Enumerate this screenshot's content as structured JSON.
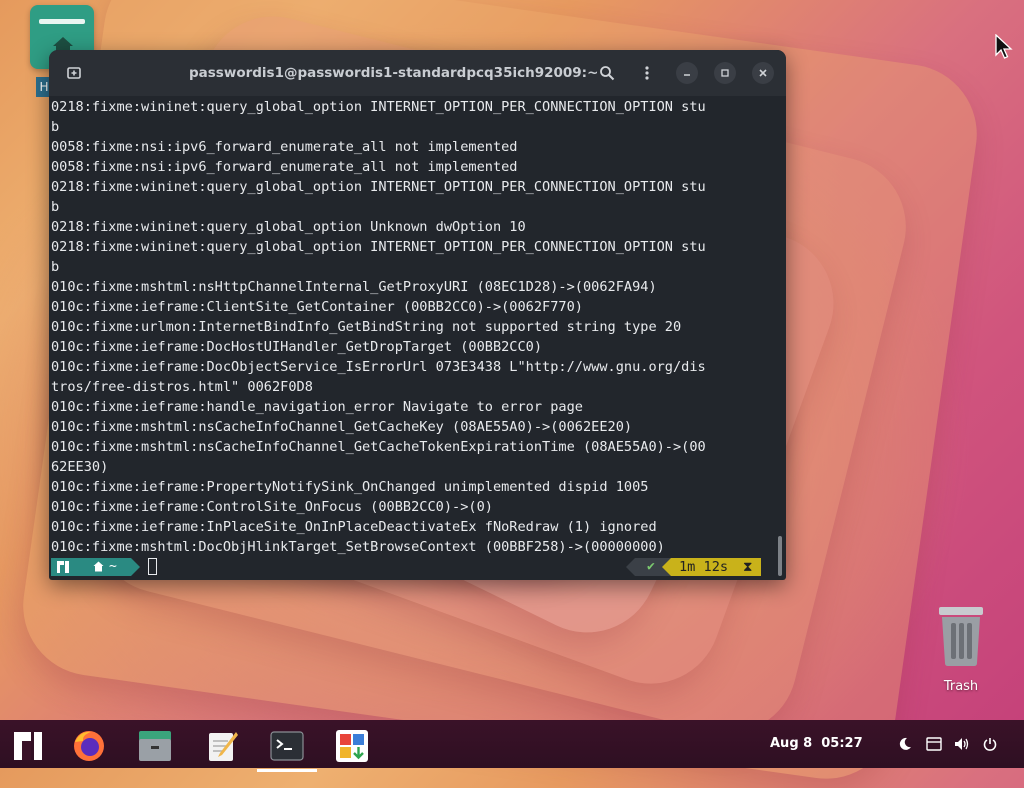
{
  "desktop": {
    "icons": [
      {
        "name": "Home",
        "label": "H"
      },
      {
        "name": "Trash",
        "label": "Trash"
      }
    ]
  },
  "terminal": {
    "title": "passwordis1@passwordis1-standardpcq35ich92009:~",
    "lines": [
      "0218:fixme:wininet:query_global_option INTERNET_OPTION_PER_CONNECTION_OPTION stu",
      "b",
      "0058:fixme:nsi:ipv6_forward_enumerate_all not implemented",
      "0058:fixme:nsi:ipv6_forward_enumerate_all not implemented",
      "0218:fixme:wininet:query_global_option INTERNET_OPTION_PER_CONNECTION_OPTION stu",
      "b",
      "0218:fixme:wininet:query_global_option Unknown dwOption 10",
      "0218:fixme:wininet:query_global_option INTERNET_OPTION_PER_CONNECTION_OPTION stu",
      "b",
      "010c:fixme:mshtml:nsHttpChannelInternal_GetProxyURI (08EC1D28)->(0062FA94)",
      "010c:fixme:ieframe:ClientSite_GetContainer (00BB2CC0)->(0062F770)",
      "010c:fixme:urlmon:InternetBindInfo_GetBindString not supported string type 20",
      "010c:fixme:ieframe:DocHostUIHandler_GetDropTarget (00BB2CC0)",
      "010c:fixme:ieframe:DocObjectService_IsErrorUrl 073E3438 L\"http://www.gnu.org/dis",
      "tros/free-distros.html\" 0062F0D8",
      "010c:fixme:ieframe:handle_navigation_error Navigate to error page",
      "010c:fixme:mshtml:nsCacheInfoChannel_GetCacheKey (08AE55A0)->(0062EE20)",
      "010c:fixme:mshtml:nsCacheInfoChannel_GetCacheTokenExpirationTime (08AE55A0)->(00",
      "62EE30)",
      "010c:fixme:ieframe:PropertyNotifySink_OnChanged unimplemented dispid 1005",
      "010c:fixme:ieframe:ControlSite_OnFocus (00BB2CC0)->(0)",
      "010c:fixme:ieframe:InPlaceSite_OnInPlaceDeactivateEx fNoRedraw (1) ignored",
      "010c:fixme:mshtml:DocObjHlinkTarget_SetBrowseContext (00BBF258)->(00000000)"
    ],
    "prompt": {
      "home_segment": "~",
      "status_ok": "✔",
      "duration": "1m 12s",
      "hourglass": "⧗"
    }
  },
  "taskbar": {
    "apps": [
      {
        "name": "Manjaro menu",
        "icon": "manjaro-logo-icon"
      },
      {
        "name": "Firefox",
        "icon": "firefox-icon"
      },
      {
        "name": "Files",
        "icon": "files-icon"
      },
      {
        "name": "Text Editor",
        "icon": "text-editor-icon"
      },
      {
        "name": "Terminal",
        "icon": "terminal-icon",
        "active": true
      },
      {
        "name": "Software",
        "icon": "software-store-icon"
      }
    ],
    "clock": {
      "date": "Aug 8",
      "time": "05:27"
    },
    "tray": [
      "night-light-icon",
      "keyboard-icon",
      "volume-icon",
      "power-icon"
    ]
  },
  "colors": {
    "terminal_bg": "#22262c",
    "titlebar_bg": "#2b2f35",
    "prompt_teal": "#2a8a82",
    "prompt_yellow": "#c9b21a",
    "taskbar_bg": "#321025"
  }
}
